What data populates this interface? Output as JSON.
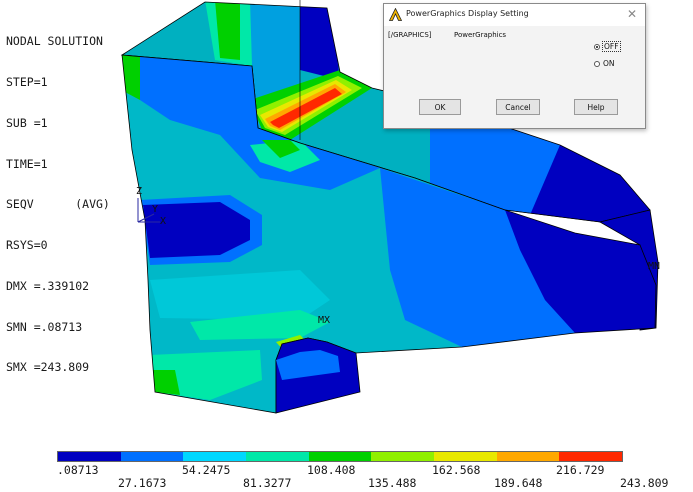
{
  "info_panel": {
    "lines": [
      "NODAL SOLUTION",
      "STEP=1",
      "SUB =1",
      "TIME=1",
      "SEQV      (AVG)",
      "RSYS=0",
      "DMX =.339102",
      "SMN =.08713",
      "SMX =243.809"
    ]
  },
  "model_labels": {
    "mx": "MX",
    "mn": "MN",
    "axis_z": "Z",
    "axis_y": "Y",
    "axis_x": "X"
  },
  "legend": {
    "colors": [
      "#0000c0",
      "#0070ff",
      "#00d8ff",
      "#00e8a8",
      "#00d000",
      "#90f000",
      "#e8e800",
      "#ffa800",
      "#ff2800"
    ],
    "upper_labels": [
      ".08713",
      "54.2475",
      "108.408",
      "162.568",
      "216.729"
    ],
    "lower_labels": [
      "27.1673",
      "81.3277",
      "135.488",
      "189.648",
      "243.809"
    ]
  },
  "dialog": {
    "title": "PowerGraphics Display Setting",
    "command": "[/GRAPHICS]",
    "field_label": "PowerGraphics",
    "options": [
      {
        "label": "OFF",
        "selected": true
      },
      {
        "label": "ON",
        "selected": false
      }
    ],
    "buttons": {
      "ok": "OK",
      "cancel": "Cancel",
      "help": "Help"
    }
  }
}
